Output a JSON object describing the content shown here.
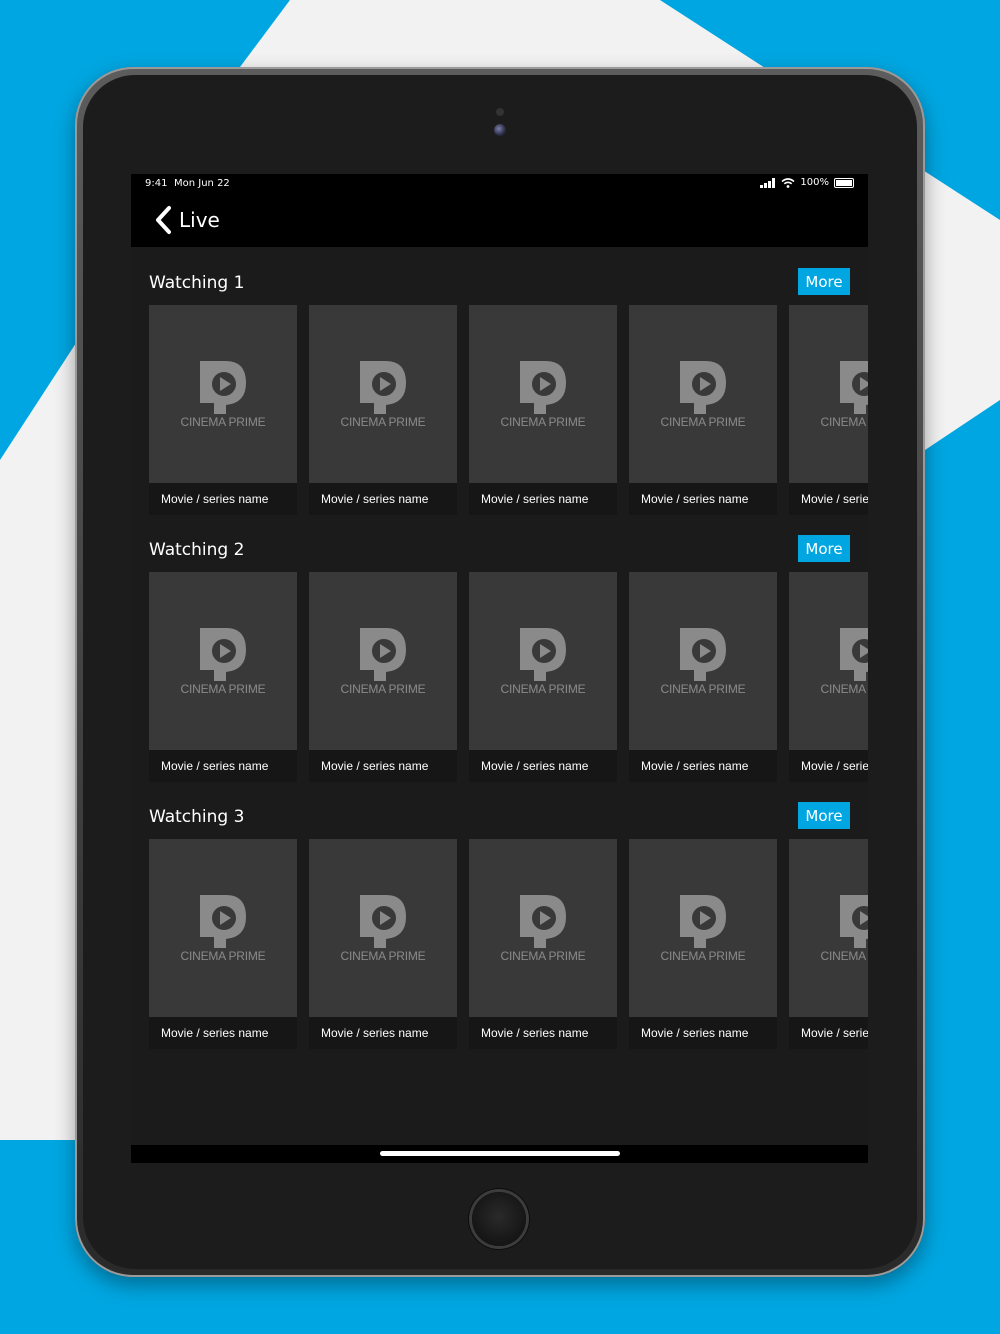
{
  "status_bar": {
    "time": "9:41",
    "date": "Mon Jun 22",
    "battery": "100%"
  },
  "nav": {
    "back_icon": "chevron-left-icon",
    "title": "Live"
  },
  "logo": {
    "icon": "cinema-prime-logo-icon",
    "text": "CINEMA PRIME"
  },
  "colors": {
    "accent": "#00a6e1",
    "background": "#1b1b1b",
    "card": "#393939"
  },
  "sections": [
    {
      "title": "Watching 1",
      "more_label": "More",
      "items": [
        {
          "name": "Movie / series name"
        },
        {
          "name": "Movie / series name"
        },
        {
          "name": "Movie / series name"
        },
        {
          "name": "Movie / series name"
        },
        {
          "name": "Movie / series name"
        }
      ]
    },
    {
      "title": "Watching 2",
      "more_label": "More",
      "items": [
        {
          "name": "Movie / series name"
        },
        {
          "name": "Movie / series name"
        },
        {
          "name": "Movie / series name"
        },
        {
          "name": "Movie / series name"
        },
        {
          "name": "Movie / series name"
        }
      ]
    },
    {
      "title": "Watching 3",
      "more_label": "More",
      "items": [
        {
          "name": "Movie / series name"
        },
        {
          "name": "Movie / series name"
        },
        {
          "name": "Movie / series name"
        },
        {
          "name": "Movie / series name"
        },
        {
          "name": "Movie / series name"
        }
      ]
    }
  ]
}
